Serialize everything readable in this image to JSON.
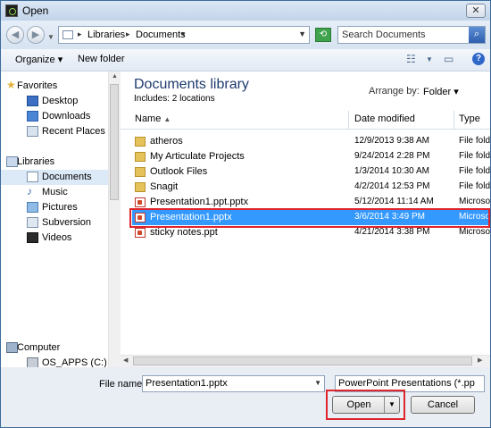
{
  "window": {
    "title": "Open",
    "close_label": "✕"
  },
  "address": {
    "crumbs": [
      "Libraries",
      "Documents"
    ],
    "search_placeholder": "Search Documents"
  },
  "toolbar": {
    "organize_label": "Organize ▾",
    "new_folder_label": "New folder"
  },
  "nav": {
    "favorites": {
      "label": "Favorites",
      "items": [
        "Desktop",
        "Downloads",
        "Recent Places"
      ]
    },
    "libraries": {
      "label": "Libraries",
      "items": [
        "Documents",
        "Music",
        "Pictures",
        "Subversion",
        "Videos"
      ]
    },
    "computer": {
      "label": "Computer",
      "items": [
        "OS_APPS (C:)"
      ]
    }
  },
  "library": {
    "title": "Documents library",
    "includes": "Includes:  2 locations",
    "arrange_label": "Arrange by:",
    "arrange_value": "Folder ▾"
  },
  "columns": {
    "name": "Name",
    "date": "Date modified",
    "type": "Type"
  },
  "files": [
    {
      "name": "atheros",
      "date": "12/9/2013 9:38 AM",
      "type": "File folder",
      "kind": "folder"
    },
    {
      "name": "My Articulate Projects",
      "date": "9/24/2014 2:28 PM",
      "type": "File folder",
      "kind": "folder"
    },
    {
      "name": "Outlook Files",
      "date": "1/3/2014 10:30 AM",
      "type": "File folder",
      "kind": "folder"
    },
    {
      "name": "Snagit",
      "date": "4/2/2014 12:53 PM",
      "type": "File folder",
      "kind": "folder"
    },
    {
      "name": "Presentation1.ppt.pptx",
      "date": "5/12/2014 11:14 AM",
      "type": "Microsoft",
      "kind": "ppt"
    },
    {
      "name": "Presentation1.pptx",
      "date": "3/6/2014 3:49 PM",
      "type": "Microsoft",
      "kind": "ppt"
    },
    {
      "name": "sticky notes.ppt",
      "date": "4/21/2014 3:38 PM",
      "type": "Microsoft",
      "kind": "ppt"
    }
  ],
  "bottom": {
    "file_name_label": "File name:",
    "file_name_value": "Presentation1.pptx",
    "filter_value": "PowerPoint Presentations (*.pp",
    "open_label": "Open",
    "cancel_label": "Cancel"
  },
  "colors": {
    "selection": "#3399ff",
    "highlight": "#e0242c"
  }
}
